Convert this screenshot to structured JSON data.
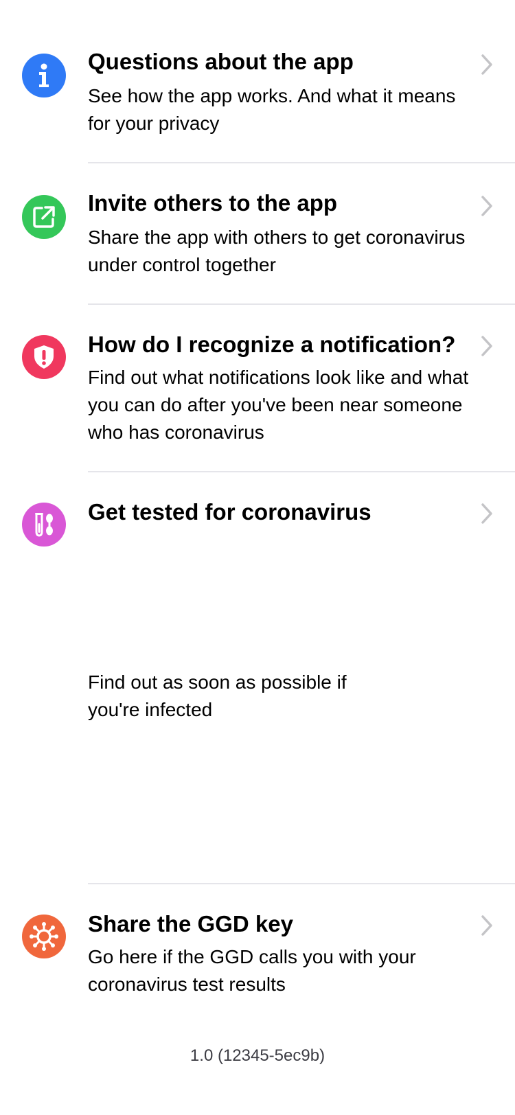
{
  "items": [
    {
      "title": "Questions about the app",
      "description": "See how the app works. And what it means for your privacy",
      "icon": "info-icon",
      "color": "#2f7af6"
    },
    {
      "title": "Invite others to the app",
      "description": "Share the app with others to get coronavirus under control together",
      "icon": "share-icon",
      "color": "#34c759"
    },
    {
      "title": "How do I recognize a notification?",
      "description": "Find out what notifications look like and what you can do after you've been near someone who has coronavirus",
      "icon": "shield-alert-icon",
      "color": "#f0385e"
    },
    {
      "title": "Get tested for coronavirus",
      "description": "Find out as soon as possible if you're infected",
      "icon": "test-tube-icon",
      "color": "#d957d6"
    },
    {
      "title": "Share the GGD key",
      "description": "Go here if the GGD calls you with your coronavirus test results",
      "icon": "virus-icon",
      "color": "#f0673c"
    }
  ],
  "version": "1.0 (12345-5ec9b)",
  "chevron_color": "#c4c4c7",
  "divider_color": "#e5e5ea"
}
